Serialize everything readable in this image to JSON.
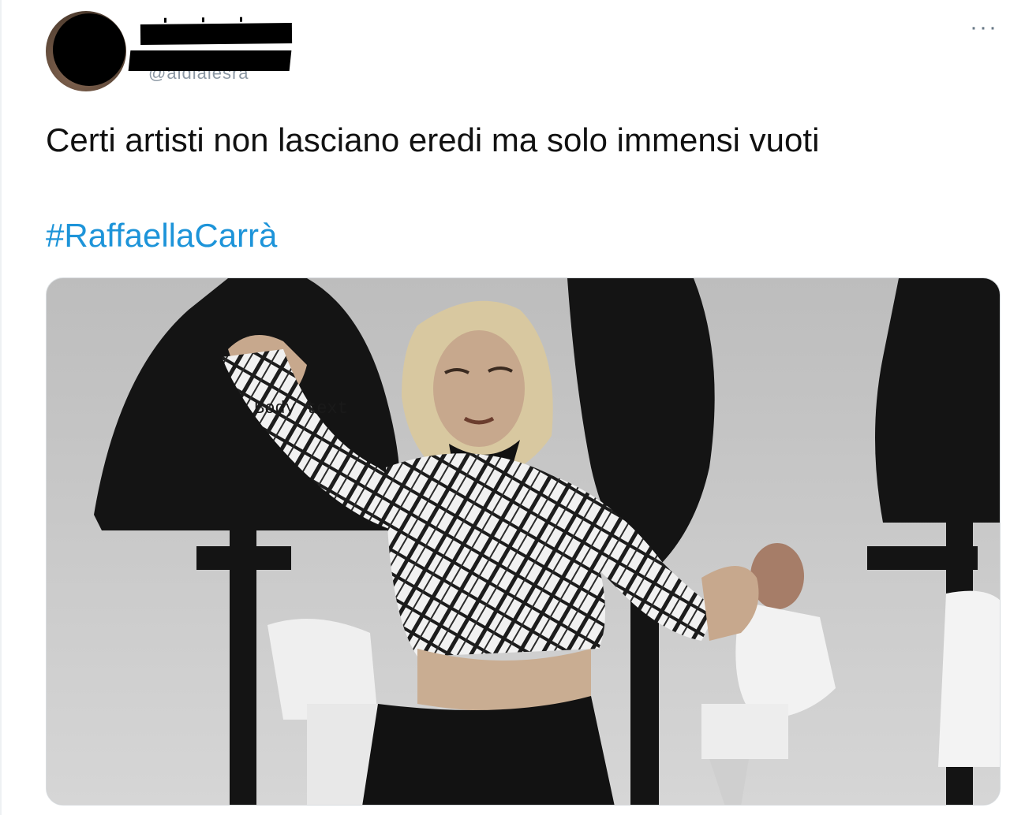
{
  "tweet": {
    "author": {
      "display_name_redacted": true,
      "handle_visible_fragment": "@aidiaiesra"
    },
    "more_icon": "more-horizontal-icon",
    "more_label": "···",
    "text": "Certi artisti non lasciano eredi ma solo immensi vuoti",
    "hashtag": "#RaffaellaCarrà",
    "media": {
      "kind": "black-and-white photo",
      "overlay_label": "Body text"
    }
  },
  "colors": {
    "text": "#111111",
    "hashtag": "#1d94d9",
    "muted": "#8c98a4",
    "border": "#eef1f3"
  }
}
